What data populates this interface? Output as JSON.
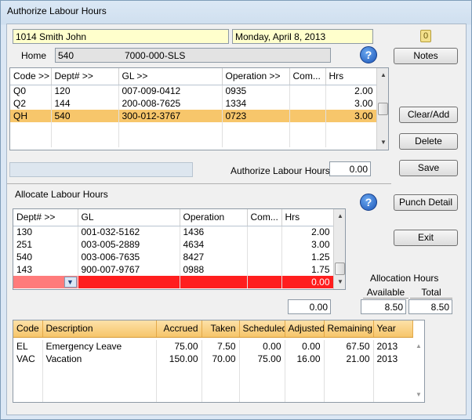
{
  "window": {
    "title": "Authorize Labour Hours"
  },
  "employee": {
    "name": "1014 Smith John",
    "date": "Monday, April 8, 2013"
  },
  "home": {
    "label": "Home",
    "dept": "540",
    "gl": "7000-000-SLS"
  },
  "icons": {
    "help": "help-icon",
    "attachment": "paperclip-icon",
    "dropdown": "chevron-down-icon"
  },
  "help_glyph": "?",
  "attach_glyph": "0",
  "scroll": {
    "up": "▲",
    "down": "▼"
  },
  "buttons": {
    "notes": "Notes",
    "clear_add": "Clear/Add",
    "delete": "Delete",
    "save": "Save",
    "punch_detail": "Punch Detail",
    "exit": "Exit"
  },
  "labour_grid": {
    "headers": [
      "Code >>",
      "Dept# >>",
      "GL >>",
      "Operation >>",
      "Com...",
      "Hrs"
    ],
    "rows": [
      {
        "code": "Q0",
        "dept": "120",
        "gl": "007-009-0412",
        "operation": "0935",
        "com": "",
        "hrs": "2.00"
      },
      {
        "code": "Q2",
        "dept": "144",
        "gl": "200-008-7625",
        "operation": "1334",
        "com": "",
        "hrs": "3.00"
      },
      {
        "code": "QH",
        "dept": "540",
        "gl": "300-012-3767",
        "operation": "0723",
        "com": "",
        "hrs": "3.00"
      }
    ]
  },
  "authorize": {
    "label": "Authorize Labour Hours",
    "value": "0.00"
  },
  "allocate": {
    "label": "Allocate Labour Hours",
    "headers": [
      "Dept# >>",
      "GL",
      "Operation",
      "Com...",
      "Hrs"
    ],
    "rows": [
      {
        "dept": "130",
        "gl": "001-032-5162",
        "operation": "1436",
        "com": "",
        "hrs": "2.00"
      },
      {
        "dept": "251",
        "gl": "003-005-2889",
        "operation": "4634",
        "com": "",
        "hrs": "3.00"
      },
      {
        "dept": "540",
        "gl": "003-006-7635",
        "operation": "8427",
        "com": "",
        "hrs": "1.25"
      },
      {
        "dept": "143",
        "gl": "900-007-9767",
        "operation": "0988",
        "com": "",
        "hrs": "1.75"
      }
    ],
    "new_row_hrs": "0.00",
    "total": "0.00"
  },
  "allocation_hours": {
    "label": "Allocation Hours",
    "available_label": "Available",
    "total_label": "Total",
    "available": "8.50",
    "total": "8.50"
  },
  "balances": {
    "headers": [
      "Code",
      "Description",
      "Accrued",
      "Taken",
      "Scheduled",
      "Adjusted",
      "Remaining",
      "Year"
    ],
    "rows": [
      {
        "code": "EL",
        "description": "Emergency Leave",
        "accrued": "75.00",
        "taken": "7.50",
        "scheduled": "0.00",
        "adjusted": "0.00",
        "remaining": "67.50",
        "year": "2013"
      },
      {
        "code": "VAC",
        "description": "Vacation",
        "accrued": "150.00",
        "taken": "70.00",
        "scheduled": "75.00",
        "adjusted": "16.00",
        "remaining": "21.00",
        "year": "2013"
      }
    ]
  }
}
